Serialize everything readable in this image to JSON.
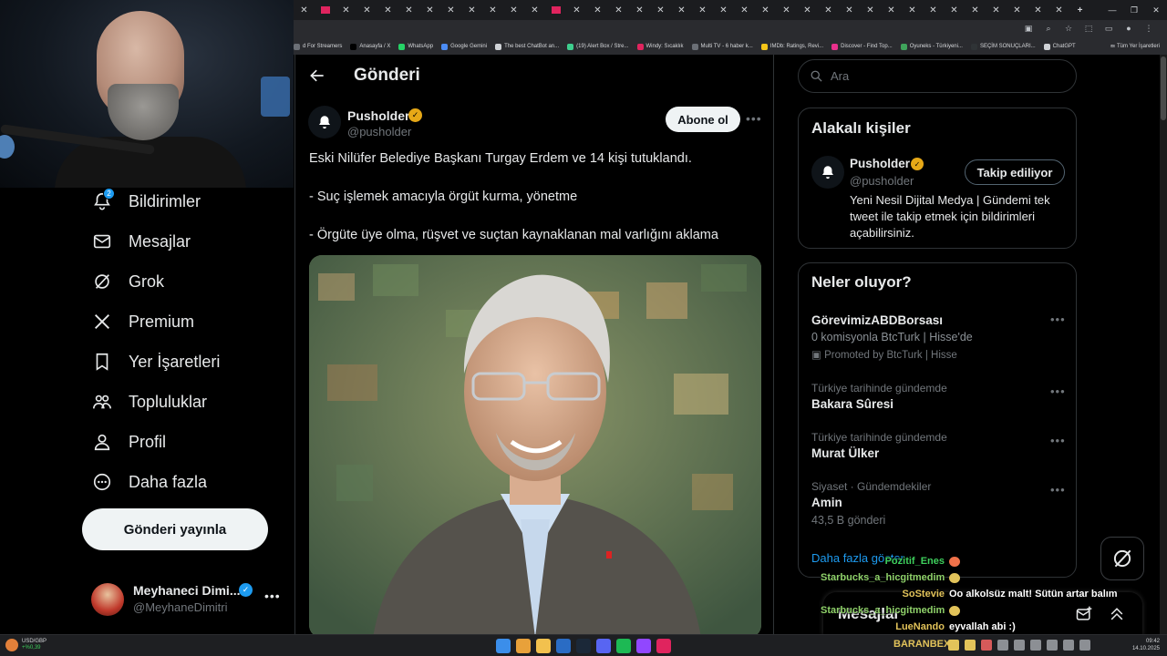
{
  "browser": {
    "tab_count": 37,
    "bookmarks": [
      {
        "label": "d For Streamers",
        "color": "#6b6f76"
      },
      {
        "label": "Anasayfa / X",
        "color": "#000000"
      },
      {
        "label": "WhatsApp",
        "color": "#25d366"
      },
      {
        "label": "Google Gemini",
        "color": "#4b8cf5"
      },
      {
        "label": "The best ChatBot an...",
        "color": "#cfd2d6"
      },
      {
        "label": "(19) Alert Box / Stre...",
        "color": "#3ecf8e"
      },
      {
        "label": "Windy: Sıcaklık",
        "color": "#e0245e"
      },
      {
        "label": "Multi TV - 6 haber k...",
        "color": "#6b6f76"
      },
      {
        "label": "IMDb: Ratings, Revi...",
        "color": "#f5c518"
      },
      {
        "label": "Discover - Find Top...",
        "color": "#e8308c"
      },
      {
        "label": "Oyuneks - Türkiyeni...",
        "color": "#3fa35b"
      },
      {
        "label": "SEÇİM SONUÇLARI...",
        "color": "#2f3336"
      },
      {
        "label": "ChatGPT",
        "color": "#cfd2d6"
      }
    ],
    "bookmarks_overflow": "»",
    "all_bookmarks": "Tüm Yer İşaretleri"
  },
  "nav": {
    "notification_badge": "2",
    "items": [
      {
        "label": "Bildirimler",
        "icon": "bell-icon"
      },
      {
        "label": "Mesajlar",
        "icon": "mail-icon"
      },
      {
        "label": "Grok",
        "icon": "grok-icon"
      },
      {
        "label": "Premium",
        "icon": "x-logo-icon"
      },
      {
        "label": "Yer İşaretleri",
        "icon": "bookmark-icon"
      },
      {
        "label": "Topluluklar",
        "icon": "communities-icon"
      },
      {
        "label": "Profil",
        "icon": "profile-icon"
      },
      {
        "label": "Daha fazla",
        "icon": "more-circle-icon"
      }
    ],
    "post_button": "Gönderi yayınla",
    "account": {
      "name": "Meyhaneci Dimi...",
      "handle": "@MeyhaneDimitri",
      "more": "•••"
    }
  },
  "main": {
    "title": "Gönderi",
    "post": {
      "author": "Pusholder",
      "handle": "@pusholder",
      "follow_label": "Abone ol",
      "more": "•••",
      "lines": [
        "Eski Nilüfer Belediye Başkanı Turgay Erdem ve 14 kişi tutuklandı.",
        "- Suç işlemek amacıyla örgüt kurma, yönetme",
        "- Örgüte üye olma, rüşvet ve suçtan kaynaklanan mal varlığını aklama"
      ]
    }
  },
  "right": {
    "search_placeholder": "Ara",
    "related": {
      "title": "Alakalı kişiler",
      "name": "Pusholder",
      "handle": "@pusholder",
      "follow_label": "Takip ediliyor",
      "bio": "Yeni Nesil Dijital Medya | Gündemi tek tweet ile takip etmek için bildirimleri açabilirsiniz."
    },
    "trends": {
      "title": "Neler oluyor?",
      "items": [
        {
          "meta": "",
          "title": "GörevimizABDBorsası",
          "sub": "0 komisyonla BtcTurk | Hisse'de",
          "promo": "Promoted by BtcTurk | Hisse"
        },
        {
          "meta": "Türkiye tarihinde gündemde",
          "title": "Bakara Sûresi",
          "sub": ""
        },
        {
          "meta": "Türkiye tarihinde gündemde",
          "title": "Murat Ülker",
          "sub": ""
        },
        {
          "meta": "Siyaset · Gündemdekiler",
          "title": "Amin",
          "sub": "43,5 B gönderi"
        }
      ],
      "show_more": "Daha fazla göster",
      "more": "•••"
    },
    "messages_drawer": "Mesajlar"
  },
  "chat": [
    {
      "user": "Pozitif_Enes",
      "msg": "",
      "color": "#3ecf5c"
    },
    {
      "user": "Starbucks_a_hicgitmedim",
      "msg": "",
      "color": "#8fd16a"
    },
    {
      "user": "SoStevie",
      "msg": "Oo alkolsüz malt! Sütün artar balım",
      "color": "#e2c35a"
    },
    {
      "user": "Starbucks_a_hicgitmedim",
      "msg": "",
      "color": "#8fd16a"
    },
    {
      "user": "LueNando",
      "msg": "eyvallah abi :)",
      "color": "#e2c35a"
    }
  ],
  "taskbar": {
    "ticker": "USD/GBP",
    "ticker_change": "+%0,39",
    "streamer": "BARANBEX",
    "time": "09:42",
    "date": "14.10.2025"
  },
  "colors": {
    "accent": "#1d9bf0",
    "gold_verified": "#e6a817",
    "background": "#000000"
  }
}
